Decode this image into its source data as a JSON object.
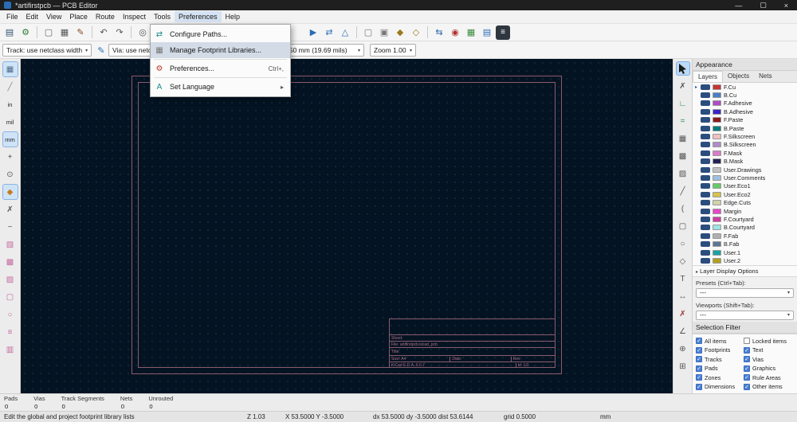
{
  "ui": {
    "dropdown_arrow": "▾",
    "submenu_arrow": "▸",
    "expander_arrow": "▸",
    "active_marker": "▸",
    "check_glyph": "✓"
  },
  "window": {
    "title": "*artifirstpcb — PCB Editor",
    "controls": {
      "minimize": "—",
      "maximize": "▢",
      "close": "×"
    }
  },
  "menubar": {
    "items": [
      "File",
      "Edit",
      "View",
      "Place",
      "Route",
      "Inspect",
      "Tools",
      "Preferences",
      "Help"
    ],
    "active": "Preferences"
  },
  "preferences_menu": {
    "items": [
      {
        "name": "configure-paths",
        "label": "Configure Paths...",
        "icon": {
          "name": "paths-icon",
          "glyph": "⇄",
          "color": "#1e8a8a"
        }
      },
      {
        "name": "manage-footprint-libraries",
        "label": "Manage Footprint Libraries...",
        "highlighted": true,
        "icon": {
          "name": "footprint-library-icon",
          "glyph": "▦",
          "color": "#777777"
        }
      },
      {
        "sep": true
      },
      {
        "name": "preferences",
        "label": "Preferences...",
        "shortcut": "Ctrl+,",
        "icon": {
          "name": "gear-icon",
          "glyph": "⚙",
          "color": "#c0392b"
        }
      },
      {
        "sep": true
      },
      {
        "name": "set-language",
        "label": "Set Language",
        "submenu": true,
        "icon": {
          "name": "language-icon",
          "glyph": "A",
          "color": "#1e8a8a"
        }
      }
    ]
  },
  "toolbar_top": {
    "icons": [
      {
        "name": "save-icon",
        "glyph": "▤",
        "color": "#33536f"
      },
      {
        "name": "board-setup-icon",
        "glyph": "⚙",
        "color": "#2e7d32"
      },
      {
        "sep": true
      },
      {
        "name": "page-settings-icon",
        "glyph": "▢",
        "color": "#666666"
      },
      {
        "name": "print-icon",
        "glyph": "▦",
        "color": "#555555"
      },
      {
        "name": "plot-icon",
        "glyph": "✎",
        "color": "#8a4a20"
      },
      {
        "sep": true
      },
      {
        "name": "undo-icon",
        "glyph": "↶",
        "color": "#555555"
      },
      {
        "name": "redo-icon",
        "glyph": "↷",
        "color": "#555555"
      },
      {
        "sep": true
      },
      {
        "name": "find-icon",
        "glyph": "◎",
        "color": "#555555"
      },
      {
        "name": "refresh-icon",
        "glyph": "↻",
        "color": "#555555"
      },
      {
        "space": 172
      },
      {
        "name": "flip-board-view-icon",
        "glyph": "▶",
        "color": "#2a6db5"
      },
      {
        "name": "mirror-view-icon",
        "glyph": "⇄",
        "color": "#2a6db5"
      },
      {
        "name": "show-ratsnest-icon",
        "glyph": "△",
        "color": "#2a6db5"
      },
      {
        "sep": true
      },
      {
        "name": "selection-mode-icon",
        "glyph": "▢",
        "color": "#777777"
      },
      {
        "name": "grid-mode-icon",
        "glyph": "▣",
        "color": "#777777"
      },
      {
        "name": "lock-icon",
        "glyph": "◆",
        "color": "#9a7b1c"
      },
      {
        "name": "unlock-icon",
        "glyph": "◇",
        "color": "#9a7b1c"
      },
      {
        "sep": true
      },
      {
        "name": "update-pcb-from-schematic-icon",
        "glyph": "⇆",
        "color": "#1f5fa8"
      },
      {
        "name": "drc-icon",
        "glyph": "◉",
        "color": "#b03030"
      },
      {
        "name": "footprint-editor-icon",
        "glyph": "▦",
        "color": "#3a8a3a"
      },
      {
        "name": "3d-viewer-icon",
        "glyph": "▤",
        "color": "#2a6db5"
      },
      {
        "name": "scripting-console-icon",
        "glyph": "≡",
        "color": "#ffffff",
        "dark": true
      }
    ]
  },
  "toolbar_secondary": {
    "track": {
      "value": "Track: use netclass width"
    },
    "via": {
      "value": "Via: use netclass sizes"
    },
    "grid": {
      "value": "Grid: 0.50 mm (19.69 mils)"
    },
    "zoom": {
      "value": "Zoom 1.00"
    },
    "edit_icon_glyph": "✎"
  },
  "left_toolbar": {
    "icons": [
      {
        "name": "toggle-grid-icon",
        "glyph": "▦",
        "color": "#4a6a8a",
        "selected": true
      },
      {
        "name": "drawing-sheet-icon",
        "glyph": "╱",
        "color": "#888888"
      },
      {
        "name": "units-inches-icon",
        "glyph": "in",
        "text": true
      },
      {
        "name": "units-mils-icon",
        "glyph": "mil",
        "text": true
      },
      {
        "name": "units-mm-icon",
        "glyph": "mm",
        "text": true,
        "selected": true
      },
      {
        "name": "cursor-shape-icon",
        "glyph": "+",
        "color": "#555555"
      },
      {
        "name": "polar-coordinates-icon",
        "glyph": "⊙",
        "color": "#555555"
      },
      {
        "name": "magnetic-snap-icon",
        "glyph": "◆",
        "color": "#c77b1e",
        "selected": true
      },
      {
        "name": "ratsnest-visibility-icon",
        "glyph": "✗",
        "color": "#555555"
      },
      {
        "name": "curved-ratsnest-icon",
        "glyph": "~",
        "color": "#555555"
      },
      {
        "name": "net-highlight-icon",
        "glyph": "▧",
        "color": "#c46ba0"
      },
      {
        "name": "zone-fill-icon",
        "glyph": "▩",
        "color": "#c46ba0"
      },
      {
        "name": "zone-outline-icon",
        "glyph": "▨",
        "color": "#c46ba0"
      },
      {
        "name": "pad-display-icon",
        "glyph": "▢",
        "color": "#c46ba0"
      },
      {
        "name": "via-display-icon",
        "glyph": "○",
        "color": "#c46ba0"
      },
      {
        "name": "track-display-icon",
        "glyph": "≡",
        "color": "#c46ba0"
      },
      {
        "name": "inactive-layer-display-icon",
        "glyph": "▥",
        "color": "#c46ba0"
      }
    ]
  },
  "right_toolbar": {
    "icons": [
      {
        "name": "select-tool-icon",
        "cursor": true,
        "selected": true
      },
      {
        "name": "local-ratsnest-icon",
        "glyph": "✗",
        "color": "#555555"
      },
      {
        "name": "route-tracks-icon",
        "glyph": "∟",
        "color": "#2a8a5a"
      },
      {
        "name": "route-diff-pairs-icon",
        "glyph": "=",
        "color": "#2a8a5a"
      },
      {
        "name": "place-footprint-icon",
        "glyph": "▦",
        "color": "#555555"
      },
      {
        "name": "draw-zone-icon",
        "glyph": "▩",
        "color": "#555555"
      },
      {
        "name": "rule-area-icon",
        "glyph": "▨",
        "color": "#555555"
      },
      {
        "name": "draw-line-icon",
        "glyph": "╱",
        "color": "#555555"
      },
      {
        "name": "draw-arc-icon",
        "glyph": "(",
        "color": "#555555"
      },
      {
        "name": "draw-rectangle-icon",
        "glyph": "▢",
        "color": "#555555"
      },
      {
        "name": "draw-circle-icon",
        "glyph": "○",
        "color": "#555555"
      },
      {
        "name": "draw-polygon-icon",
        "glyph": "◇",
        "color": "#555555"
      },
      {
        "name": "place-text-icon",
        "glyph": "T",
        "color": "#555555"
      },
      {
        "name": "dimension-icon",
        "glyph": "↔",
        "color": "#555555"
      },
      {
        "name": "delete-tool-icon",
        "glyph": "✗",
        "color": "#a33333"
      },
      {
        "name": "measure-tool-icon",
        "glyph": "∠",
        "color": "#555555"
      },
      {
        "name": "drill-origin-icon",
        "glyph": "⊕",
        "color": "#555555"
      },
      {
        "name": "grid-origin-icon",
        "glyph": "⊞",
        "color": "#555555"
      }
    ]
  },
  "appearance": {
    "title": "Appearance",
    "tabs": [
      {
        "label": "Layers",
        "active": true
      },
      {
        "label": "Objects"
      },
      {
        "label": "Nets"
      }
    ],
    "active_layer": "F.Cu",
    "layers": [
      {
        "name": "F.Cu",
        "color": "#C83434"
      },
      {
        "name": "B.Cu",
        "color": "#4D7FC4"
      },
      {
        "name": "F.Adhesive",
        "color": "#AF4CC5"
      },
      {
        "name": "B.Adhesive",
        "color": "#3B25C4"
      },
      {
        "name": "F.Paste",
        "color": "#8B1A1A"
      },
      {
        "name": "B.Paste",
        "color": "#007B7C"
      },
      {
        "name": "F.Silkscreen",
        "color": "#F0C0BE"
      },
      {
        "name": "B.Silkscreen",
        "color": "#AE8CC8"
      },
      {
        "name": "F.Mask",
        "color": "#D87CC8"
      },
      {
        "name": "B.Mask",
        "color": "#232355"
      },
      {
        "name": "User.Drawings",
        "color": "#C2C2C2"
      },
      {
        "name": "User.Comments",
        "color": "#A0C0E0"
      },
      {
        "name": "User.Eco1",
        "color": "#69C969"
      },
      {
        "name": "User.Eco2",
        "color": "#D6C24A"
      },
      {
        "name": "Edge.Cuts",
        "color": "#D0D2AA"
      },
      {
        "name": "Margin",
        "color": "#E848C8"
      },
      {
        "name": "F.Courtyard",
        "color": "#D03CA0"
      },
      {
        "name": "B.Courtyard",
        "color": "#9CE3E3"
      },
      {
        "name": "F.Fab",
        "color": "#AFAFAF"
      },
      {
        "name": "B.Fab",
        "color": "#5E7596"
      },
      {
        "name": "User.1",
        "color": "#19A2A2"
      },
      {
        "name": "User.2",
        "color": "#B3A021"
      }
    ],
    "layer_display_options": "Layer Display Options",
    "presets_label": "Presets (Ctrl+Tab):",
    "presets_value": "---",
    "viewports_label": "Viewports (Shift+Tab):",
    "viewports_value": "---"
  },
  "selection_filter": {
    "title": "Selection Filter",
    "items": [
      {
        "label": "All items",
        "checked": true
      },
      {
        "label": "Locked items",
        "checked": false
      },
      {
        "label": "Footprints",
        "checked": true
      },
      {
        "label": "Text",
        "checked": true
      },
      {
        "label": "Tracks",
        "checked": true
      },
      {
        "label": "Vias",
        "checked": true
      },
      {
        "label": "Pads",
        "checked": true
      },
      {
        "label": "Graphics",
        "checked": true
      },
      {
        "label": "Zones",
        "checked": true
      },
      {
        "label": "Rule Areas",
        "checked": true
      },
      {
        "label": "Dimensions",
        "checked": true
      },
      {
        "label": "Other items",
        "checked": true
      }
    ]
  },
  "canvas": {
    "title_block": {
      "sheet_label": "Sheet:",
      "file": "File: artifirstpcb.kicad_pcb",
      "title_label": "Title:",
      "size": "Size: A4",
      "date": "Date:",
      "rev": "Rev:",
      "brand": "KiCad E.D.A. 6.0.7",
      "id": "Id: 1/1"
    }
  },
  "message_panel": {
    "items": [
      {
        "label": "Pads",
        "value": "0"
      },
      {
        "label": "Vias",
        "value": "0"
      },
      {
        "label": "Track Segments",
        "value": "0"
      },
      {
        "label": "Nets",
        "value": "0"
      },
      {
        "label": "Unrouted",
        "value": "0"
      }
    ]
  },
  "status_bar": {
    "hint": "Edit the global and project footprint library lists",
    "zoom": "Z 1.03",
    "position": "X 53.5000 Y -3.5000",
    "delta": "dx 53.5000 dy -3.5000 dist 53.6144",
    "grid": "grid 0.5000",
    "units": "mm"
  }
}
